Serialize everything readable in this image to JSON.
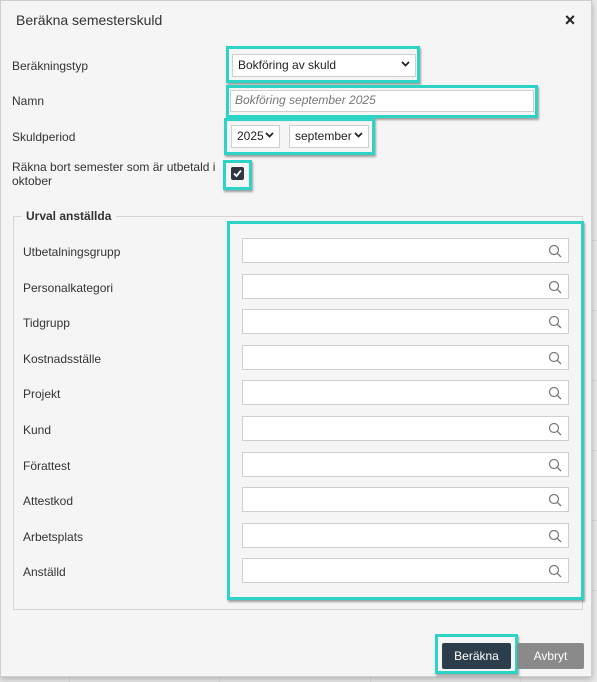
{
  "dialog": {
    "title": "Beräkna semesterskuld",
    "close_glyph": "×"
  },
  "form": {
    "calc_type_label": "Beräkningstyp",
    "calc_type_value": "Bokföring av skuld",
    "name_label": "Namn",
    "name_value": "Bokföring september 2025",
    "period_label": "Skuldperiod",
    "period_year": "2025",
    "period_month": "september",
    "exclude_label": "Räkna bort semester som är utbetald i oktober",
    "exclude_checked": true
  },
  "selection": {
    "legend": "Urval anställda",
    "fields": [
      {
        "label": "Utbetalningsgrupp",
        "value": ""
      },
      {
        "label": "Personalkategori",
        "value": ""
      },
      {
        "label": "Tidgrupp",
        "value": ""
      },
      {
        "label": "Kostnadsställe",
        "value": ""
      },
      {
        "label": "Projekt",
        "value": ""
      },
      {
        "label": "Kund",
        "value": ""
      },
      {
        "label": "Förattest",
        "value": ""
      },
      {
        "label": "Attestkod",
        "value": ""
      },
      {
        "label": "Arbetsplats",
        "value": ""
      },
      {
        "label": "Anställd",
        "value": ""
      }
    ]
  },
  "actions": {
    "calculate": "Beräkna",
    "cancel": "Avbryt"
  },
  "colors": {
    "highlight": "#2dd4c6",
    "primary_button": "#2c3e4c",
    "secondary_button": "#8a8a8a"
  },
  "icons": {
    "close": "close-icon",
    "dropdown": "chevron-down-icon",
    "search": "search-icon",
    "checkbox": "checkmark-icon"
  }
}
